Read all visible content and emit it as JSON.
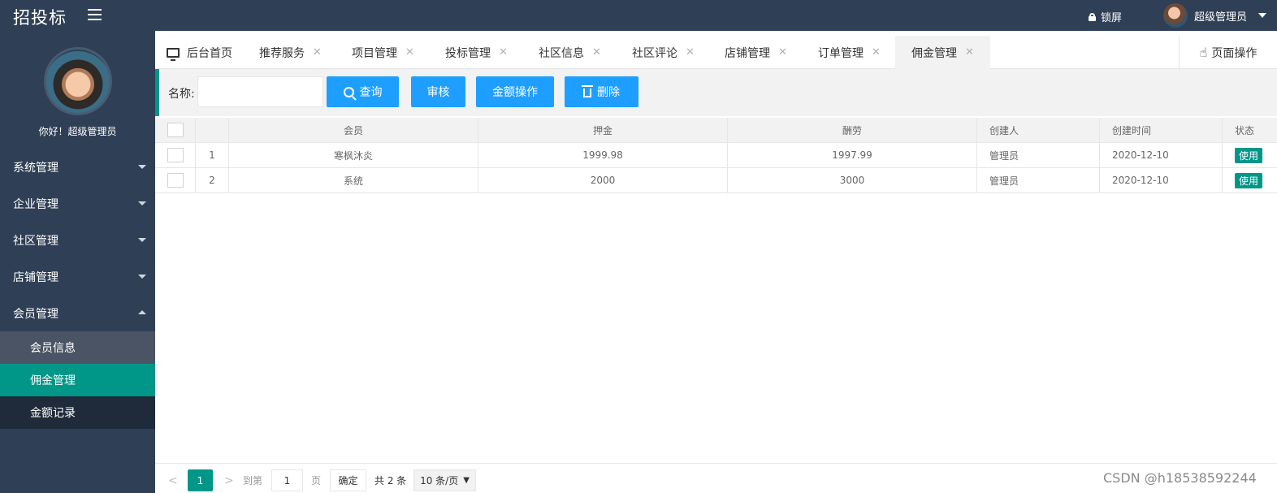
{
  "header": {
    "logo": "招投标",
    "lock_label": "锁屏",
    "user_name": "超级管理员"
  },
  "sidebar": {
    "greeting": "你好！超级管理员",
    "menu": [
      {
        "label": "系统管理"
      },
      {
        "label": "企业管理"
      },
      {
        "label": "社区管理"
      },
      {
        "label": "店铺管理"
      },
      {
        "label": "会员管理"
      }
    ],
    "submenu": [
      {
        "label": "会员信息"
      },
      {
        "label": "佣金管理"
      },
      {
        "label": "金额记录"
      }
    ]
  },
  "tabs": {
    "home": "后台首页",
    "items": [
      {
        "label": "推荐服务"
      },
      {
        "label": "项目管理"
      },
      {
        "label": "投标管理"
      },
      {
        "label": "社区信息"
      },
      {
        "label": "社区评论"
      },
      {
        "label": "店铺管理"
      },
      {
        "label": "订单管理"
      },
      {
        "label": "佣金管理"
      }
    ],
    "close_glyph": "✕",
    "page_op": "页面操作"
  },
  "toolbar": {
    "name_label": "名称:",
    "search_label": "查询",
    "audit_label": "审核",
    "amount_label": "金额操作",
    "delete_label": "删除"
  },
  "table": {
    "headers": [
      "会员",
      "押金",
      "酬劳",
      "创建人",
      "创建时间",
      "状态"
    ],
    "rows": [
      {
        "no": "1",
        "member": "寒枫沐炎",
        "deposit": "1999.98",
        "reward": "1997.99",
        "creator": "管理员",
        "created": "2020-12-10",
        "status": "使用"
      },
      {
        "no": "2",
        "member": "系统",
        "deposit": "2000",
        "reward": "3000",
        "creator": "管理员",
        "created": "2020-12-10",
        "status": "使用"
      }
    ]
  },
  "pager": {
    "prev": "<",
    "current": "1",
    "next": ">",
    "goto_label": "到第",
    "goto_value": "1",
    "page_unit": "页",
    "confirm": "确定",
    "total": "共 2 条",
    "page_size": "10 条/页"
  },
  "watermark": "CSDN @h18538592244"
}
